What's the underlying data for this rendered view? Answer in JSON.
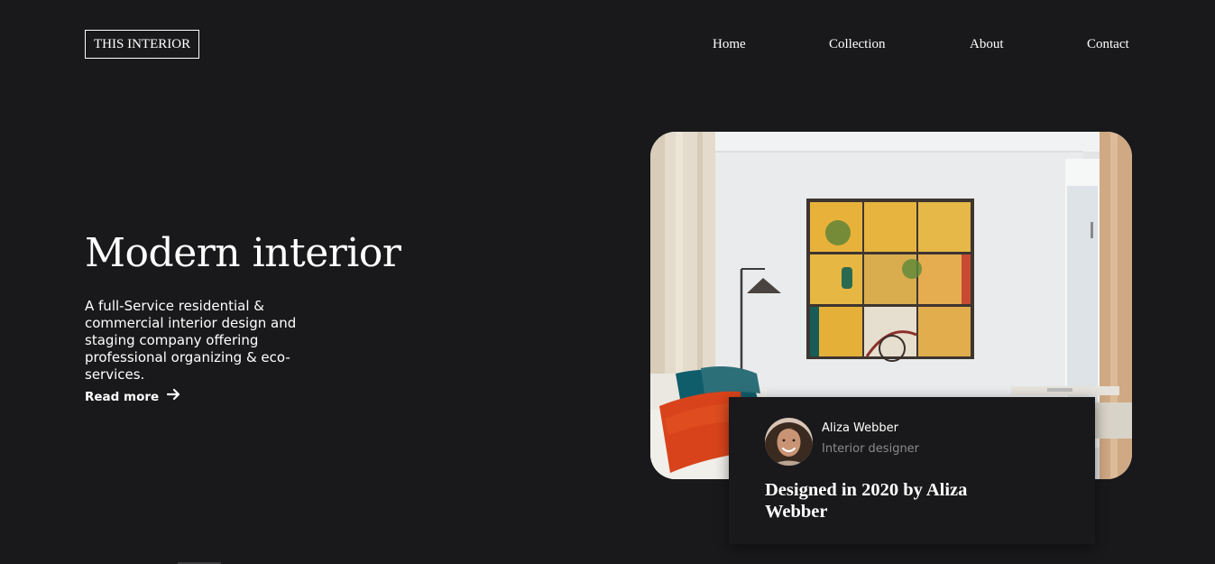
{
  "brand": {
    "logo_text": "THIS INTERIOR"
  },
  "nav": {
    "items": [
      "Home",
      "Collection",
      "About",
      "Contact"
    ]
  },
  "hero": {
    "title": "Modern interior",
    "description": "A full-Service residential & commercial interior design and staging company offering professional organizing & eco-services.",
    "cta_label": "Read more",
    "cta_icon": "arrow-right-icon"
  },
  "feature": {
    "image_subject": "living room with yellow grid wall art",
    "author_name": "Aliza Webber",
    "author_role": "Interior designer",
    "caption": "Designed in 2020 by Aliza Webber"
  },
  "colors": {
    "background": "#19191b",
    "text": "#ffffff",
    "muted_text": "#8a8a8a",
    "art_yellow": "#e9b637",
    "pillow_orange": "#d9431b",
    "pillow_teal": "#0f5d6b"
  }
}
